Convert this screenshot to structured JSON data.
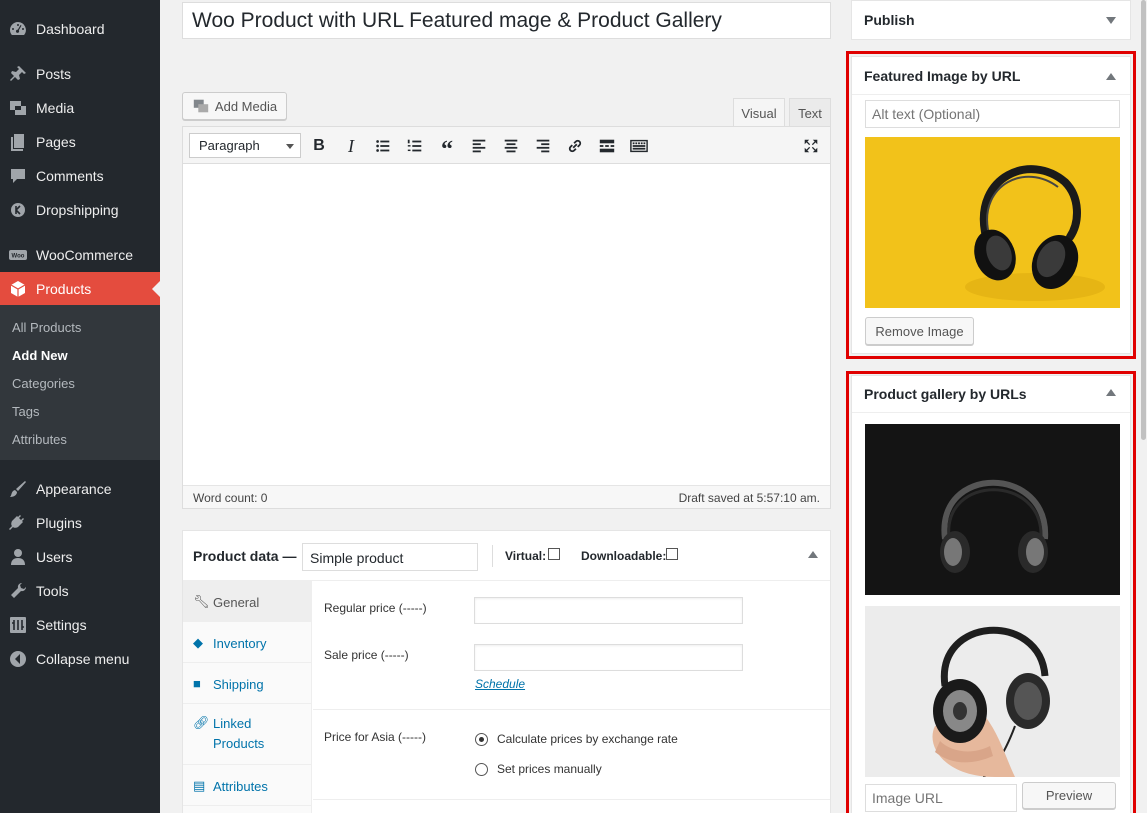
{
  "sidebar": {
    "items": [
      {
        "label": "Dashboard",
        "icon": "dashboard-icon"
      },
      {
        "label": "Posts",
        "icon": "pin-icon"
      },
      {
        "label": "Media",
        "icon": "media-icon"
      },
      {
        "label": "Pages",
        "icon": "pages-icon"
      },
      {
        "label": "Comments",
        "icon": "comment-icon"
      },
      {
        "label": "Dropshipping",
        "icon": "dropshipping-icon"
      },
      {
        "label": "WooCommerce",
        "icon": "woocommerce-icon"
      },
      {
        "label": "Products",
        "icon": "box-icon",
        "active": true
      },
      {
        "label": "Appearance",
        "icon": "brush-icon"
      },
      {
        "label": "Plugins",
        "icon": "plug-icon"
      },
      {
        "label": "Users",
        "icon": "user-icon"
      },
      {
        "label": "Tools",
        "icon": "wrench-icon"
      },
      {
        "label": "Settings",
        "icon": "settings-icon"
      },
      {
        "label": "Collapse menu",
        "icon": "collapse-icon"
      }
    ],
    "submenu": [
      "All Products",
      "Add New",
      "Categories",
      "Tags",
      "Attributes"
    ],
    "submenu_current": "Add New",
    "woo_badge": "Woo"
  },
  "editor": {
    "title": "Woo Product with URL Featured mage & Product Gallery",
    "add_media_label": "Add Media",
    "tabs": [
      "Visual",
      "Text"
    ],
    "active_tab": "Visual",
    "format_select": "Paragraph",
    "word_count": "Word count: 0",
    "draft_saved": "Draft saved at 5:57:10 am."
  },
  "product_data": {
    "title": "Product data —",
    "type": "Simple product",
    "virtual_label": "Virtual:",
    "downloadable_label": "Downloadable:",
    "tabs": [
      {
        "label": "General",
        "icon": "wrench-icon",
        "active": true
      },
      {
        "label": "Inventory",
        "icon": "diamond-icon"
      },
      {
        "label": "Shipping",
        "icon": "truck-icon"
      },
      {
        "label": "Linked Products",
        "icon": "link-icon"
      },
      {
        "label": "Attributes",
        "icon": "list-icon"
      }
    ],
    "regular_price_label": "Regular price (-----)",
    "sale_price_label": "Sale price (-----)",
    "schedule_link": "Schedule",
    "price_asia_label": "Price for Asia (-----)",
    "radio_options": [
      "Calculate prices by exchange rate",
      "Set prices manually"
    ],
    "radio_selected": "Calculate prices by exchange rate"
  },
  "publish": {
    "title": "Publish"
  },
  "featured_image": {
    "title": "Featured Image by URL",
    "alt_placeholder": "Alt text (Optional)",
    "remove_label": "Remove Image"
  },
  "gallery": {
    "title": "Product gallery by URLs",
    "url_placeholder": "Image URL",
    "preview_label": "Preview"
  },
  "colors": {
    "sidebar_bg": "#23282d",
    "active_menu": "#e44c3e",
    "highlight_frame": "#e00000",
    "link": "#0073aa"
  }
}
